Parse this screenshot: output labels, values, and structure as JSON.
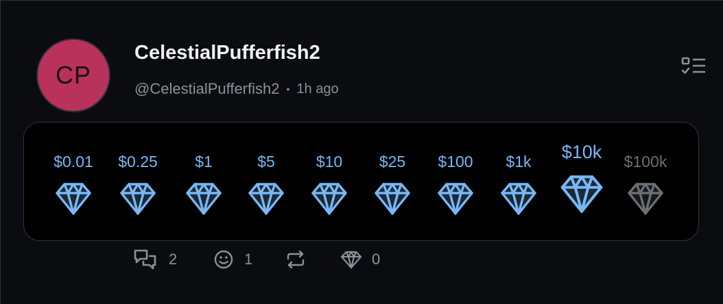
{
  "post": {
    "avatar_initials": "CP",
    "avatar_color": "#b8325c",
    "display_name": "CelestialPufferfish2",
    "handle": "@CelestialPufferfish2",
    "separator": "•",
    "time": "1h ago"
  },
  "tips": [
    {
      "label": "$0.01",
      "enabled": true
    },
    {
      "label": "$0.25",
      "enabled": true
    },
    {
      "label": "$1",
      "enabled": true
    },
    {
      "label": "$5",
      "enabled": true
    },
    {
      "label": "$10",
      "enabled": true
    },
    {
      "label": "$25",
      "enabled": true
    },
    {
      "label": "$100",
      "enabled": true
    },
    {
      "label": "$1k",
      "enabled": true
    },
    {
      "label": "$10k",
      "enabled": true,
      "highlighted": true
    },
    {
      "label": "$100k",
      "enabled": false
    }
  ],
  "actions": {
    "replies": {
      "icon": "chat-bubbles-icon",
      "count": "2"
    },
    "reactions": {
      "icon": "smiley-icon",
      "count": "1"
    },
    "repost": {
      "icon": "repost-icon",
      "count": ""
    },
    "tips": {
      "icon": "gem-icon",
      "count": "0"
    }
  },
  "colors": {
    "accent": "#79b8f5",
    "disabled": "#6b6f76",
    "muted_text": "#8b919a",
    "background": "#0b0c10"
  }
}
